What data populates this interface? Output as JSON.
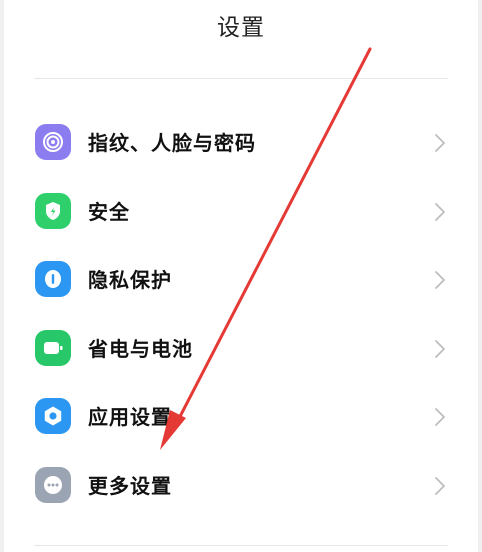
{
  "header": {
    "title": "设置"
  },
  "colors": {
    "fingerprint": "#8b7cf0",
    "security": "#2fcf6c",
    "privacy": "#2b97f3",
    "battery": "#28c86a",
    "apps": "#2b97f3",
    "more": "#9aa4b3",
    "annotation_arrow": "#e53935"
  },
  "settings": {
    "items": [
      {
        "label": "指纹、人脸与密码",
        "icon": "fingerprint-icon"
      },
      {
        "label": "安全",
        "icon": "shield-icon"
      },
      {
        "label": "隐私保护",
        "icon": "privacy-icon"
      },
      {
        "label": "省电与电池",
        "icon": "battery-icon"
      },
      {
        "label": "应用设置",
        "icon": "gear-icon"
      },
      {
        "label": "更多设置",
        "icon": "more-icon"
      }
    ]
  }
}
